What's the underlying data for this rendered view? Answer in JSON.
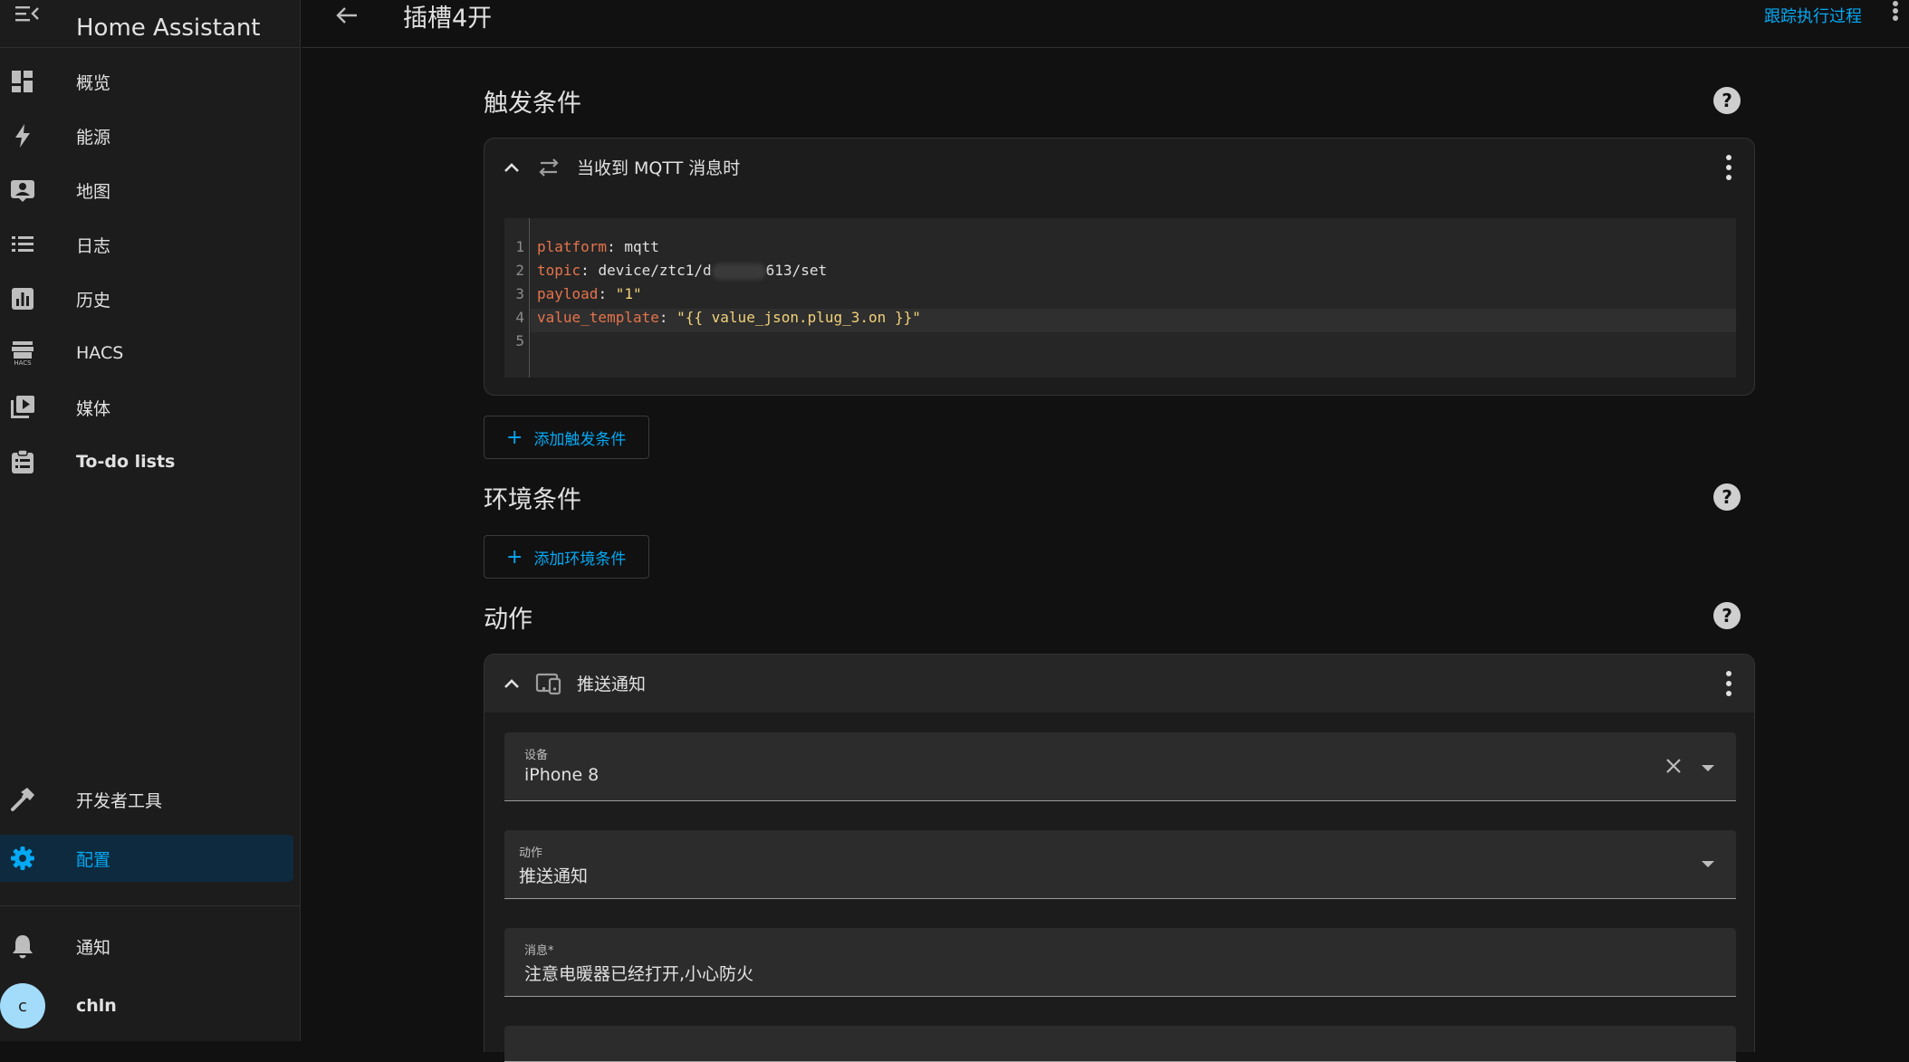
{
  "app": {
    "title": "Home Assistant"
  },
  "sidebar": {
    "items": [
      {
        "label": "概览",
        "icon": "dashboard-icon"
      },
      {
        "label": "能源",
        "icon": "lightning-icon"
      },
      {
        "label": "地图",
        "icon": "map-account-icon"
      },
      {
        "label": "日志",
        "icon": "list-icon"
      },
      {
        "label": "历史",
        "icon": "chart-box-icon"
      },
      {
        "label": "HACS",
        "icon": "hacs-store-icon"
      },
      {
        "label": "媒体",
        "icon": "media-play-icon"
      },
      {
        "label": "To-do lists",
        "icon": "clipboard-list-icon"
      }
    ],
    "bottom": [
      {
        "label": "开发者工具",
        "icon": "hammer-icon"
      },
      {
        "label": "配置",
        "icon": "gear-icon",
        "active": true
      }
    ],
    "notifications_label": "通知",
    "user": {
      "initial": "c",
      "name": "chln"
    }
  },
  "topbar": {
    "title": "插槽4开",
    "trace_link": "跟踪执行过程"
  },
  "triggers": {
    "title": "触发条件",
    "card_title": "当收到 MQTT 消息时",
    "code": {
      "line_numbers": [
        "1",
        "2",
        "3",
        "4",
        "5"
      ],
      "lines": [
        {
          "key": "platform",
          "value": "mqtt"
        },
        {
          "key": "topic",
          "value": "device/ztc1/d",
          "value_tail": "613/set"
        },
        {
          "key": "payload",
          "value": "\"1\""
        },
        {
          "key": "value_template",
          "value": "\"{{ value_json.plug_3.on }}\""
        }
      ]
    },
    "add_label": "添加触发条件"
  },
  "conditions": {
    "title": "环境条件",
    "add_label": "添加环境条件"
  },
  "actions": {
    "title": "动作",
    "card_title": "推送通知",
    "fields": [
      {
        "label": "设备",
        "value": "iPhone 8"
      },
      {
        "label": "动作",
        "value": "推送通知"
      },
      {
        "label": "消息*",
        "value": "注意电暖器已经打开,小心防火"
      }
    ]
  },
  "colors": {
    "accent": "#03a9f4",
    "background": "#111111",
    "sidebar": "#1c1c1c",
    "active_bg": "#0e2a3f"
  }
}
